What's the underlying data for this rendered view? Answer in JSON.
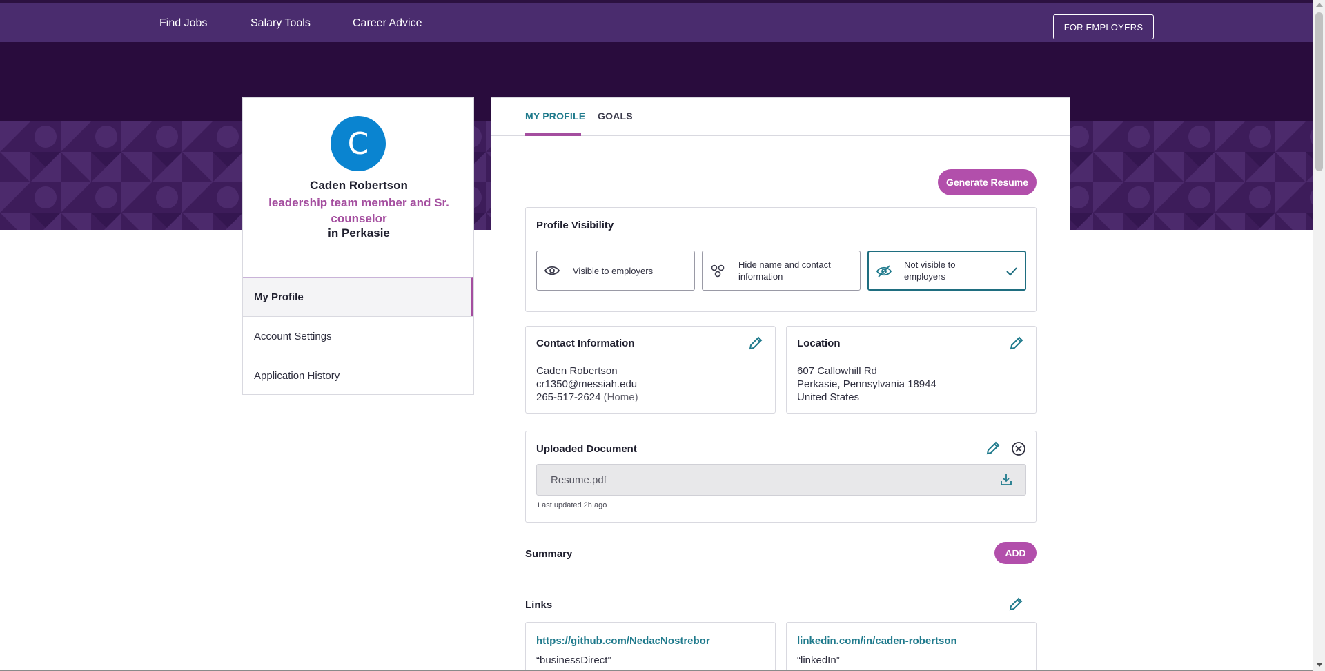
{
  "topnav": {
    "links": [
      "Find Jobs",
      "Salary Tools",
      "Career Advice"
    ],
    "employers_button": "FOR EMPLOYERS"
  },
  "profile": {
    "avatar_initial": "C",
    "name": "Caden Robertson",
    "title": "leadership team member and Sr. counselor",
    "location": "in Perkasie"
  },
  "sidebar": {
    "items": [
      {
        "label": "My Profile",
        "active": true
      },
      {
        "label": "Account Settings",
        "active": false
      },
      {
        "label": "Application History",
        "active": false
      }
    ]
  },
  "tabs": [
    {
      "label": "MY PROFILE",
      "active": true
    },
    {
      "label": "GOALS",
      "active": false
    }
  ],
  "generate_resume_label": "Generate Resume",
  "visibility": {
    "title": "Profile Visibility",
    "options": [
      {
        "label": "Visible to employers",
        "icon": "eye-icon"
      },
      {
        "label": "Hide name and contact information",
        "icon": "people-icon"
      },
      {
        "label": "Not visible to employers",
        "icon": "eye-slash-icon",
        "selected": true
      }
    ]
  },
  "contact": {
    "title": "Contact Information",
    "name": "Caden Robertson",
    "email": "cr1350@messiah.edu",
    "phone": "265-517-2624",
    "phone_type": "(Home)"
  },
  "location": {
    "title": "Location",
    "street": "607 Callowhill Rd",
    "city_line": "Perkasie, Pennsylvania 18944",
    "country": "United States"
  },
  "document": {
    "title": "Uploaded Document",
    "filename": "Resume.pdf",
    "updated": "Last updated 2h ago"
  },
  "summary": {
    "title": "Summary",
    "add_label": "ADD"
  },
  "links": {
    "title": "Links",
    "items": [
      {
        "url": "https://github.com/NedacNostrebor",
        "label": "“businessDirect”"
      },
      {
        "url": "linkedin.com/in/caden-robertson",
        "label": "“linkedIn”"
      }
    ]
  },
  "colors": {
    "nav": "#4a2c6e",
    "hero": "#290c3d",
    "accent_purple": "#b24fab",
    "teal": "#1f7a8c",
    "avatar": "#0a84d0"
  }
}
